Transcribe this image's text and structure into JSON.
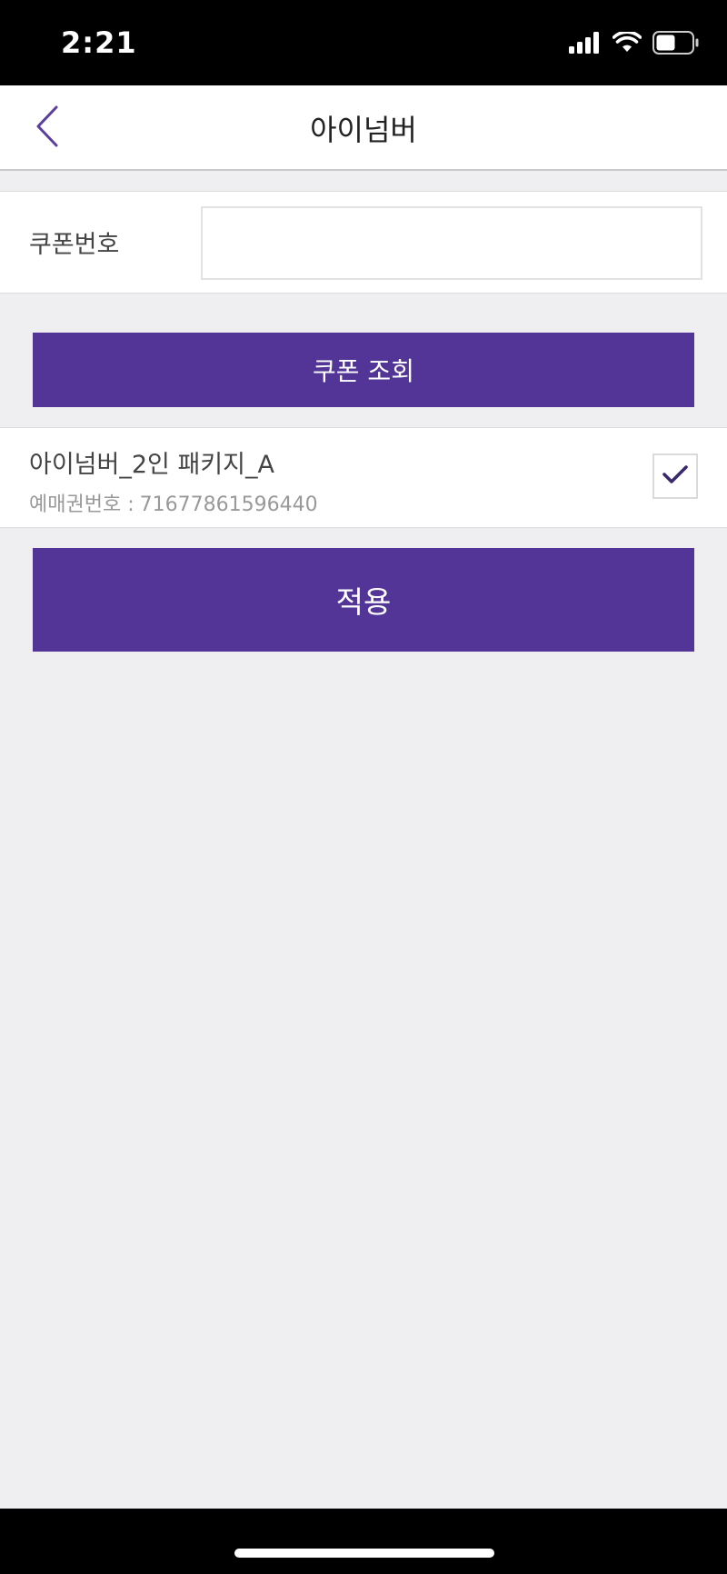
{
  "status_bar": {
    "time": "2:21",
    "icons": [
      "cellular-signal-icon",
      "wifi-icon",
      "battery-icon"
    ]
  },
  "nav": {
    "title": "아이넘버",
    "back_icon": "chevron-left-icon"
  },
  "coupon": {
    "label": "쿠폰번호",
    "input_value": "",
    "placeholder": ""
  },
  "lookup_button": {
    "label": "쿠폰 조회"
  },
  "ticket": {
    "name": "아이넘버_2인 패키지_A",
    "number_label": "예매권번호 :",
    "number_value": "71677861596440",
    "checked": true
  },
  "apply_button": {
    "label": "적용"
  },
  "colors": {
    "accent": "#523596",
    "background": "#efeef0",
    "check_mark": "#3a2a6b"
  }
}
